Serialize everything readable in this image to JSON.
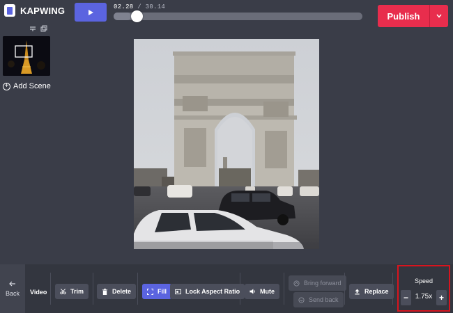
{
  "app": {
    "name": "KAPWING"
  },
  "player": {
    "current_time": "02.28",
    "separator": "/",
    "total_time": "30.14",
    "progress": 0.07
  },
  "publish": {
    "label": "Publish"
  },
  "scenes": {
    "add_label": "Add Scene"
  },
  "toolbar": {
    "back_label": "Back",
    "section_label": "Video",
    "trim": "Trim",
    "delete": "Delete",
    "fill": "Fill",
    "lock_aspect": "Lock Aspect Ratio",
    "mute": "Mute",
    "bring_forward": "Bring forward",
    "send_back": "Send back",
    "replace": "Replace"
  },
  "speed": {
    "label": "Speed",
    "value": "1.75x",
    "minus": "−",
    "plus": "+"
  },
  "colors": {
    "background": "#3a3d48",
    "accent": "#5b64e0",
    "publish": "#e82d4d",
    "highlight_box": "#d8141e"
  },
  "icons": {
    "logo": "kapwing-logo-icon",
    "play": "play-icon",
    "caret": "chevron-down-icon",
    "trim": "scissors-icon",
    "delete": "trash-icon",
    "fill": "expand-icon",
    "lock_aspect": "aspect-ratio-icon",
    "mute": "speaker-icon",
    "bring_forward": "layers-up-icon",
    "send_back": "layers-down-icon",
    "replace": "upload-icon",
    "back": "arrow-left-icon"
  }
}
